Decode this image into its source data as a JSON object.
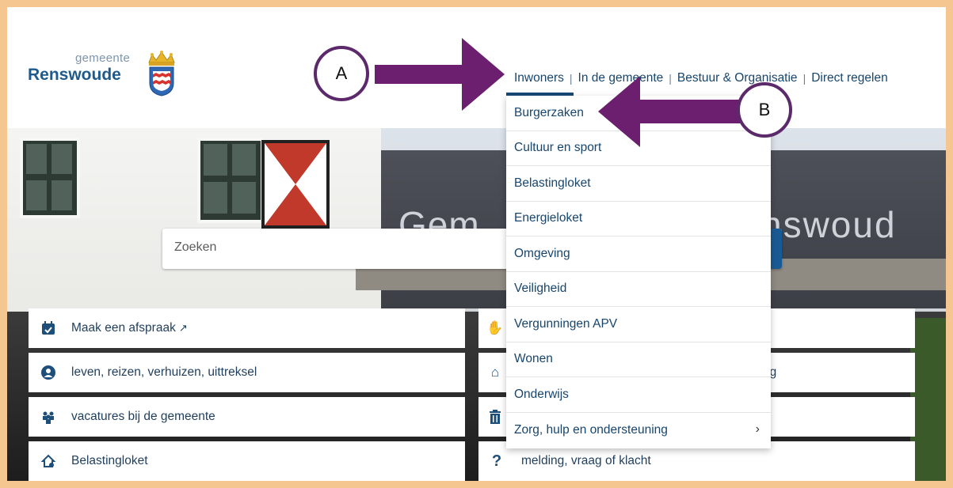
{
  "logo": {
    "small": "gemeente",
    "name": "Renswoude"
  },
  "nav": {
    "items": [
      "Inwoners",
      "In de gemeente",
      "Bestuur & Organisatie",
      "Direct regelen"
    ],
    "separator": "|"
  },
  "hero": {
    "sign_text_left": "Gem",
    "sign_text_right": "nswoud"
  },
  "search": {
    "placeholder": "Zoeken"
  },
  "quick_links_left": [
    {
      "icon": "calendar-check-icon",
      "label": "Maak een afspraak"
    },
    {
      "icon": "user-circle-icon",
      "label": "leven, reizen, verhuizen, uittreksel"
    },
    {
      "icon": "people-group-icon",
      "label": "vacatures bij de gemeente"
    },
    {
      "icon": "house-coin-icon",
      "label": "Belastingloket"
    }
  ],
  "quick_links_right": [
    {
      "icon": "hands-icon",
      "label": ""
    },
    {
      "icon": "house-user-icon",
      "label": "ng"
    },
    {
      "icon": "trash-icon",
      "label": ""
    },
    {
      "icon": "question-icon",
      "label": "melding, vraag of klacht"
    }
  ],
  "dropdown": {
    "items": [
      "Burgerzaken",
      "Cultuur en sport",
      "Belastingloket",
      "Energieloket",
      "Omgeving",
      "Veiligheid",
      "Vergunningen APV",
      "Wonen",
      "Onderwijs",
      "Zorg, hulp en ondersteuning"
    ],
    "chevron": "›"
  },
  "annotations": {
    "a": "A",
    "b": "B",
    "arrow_color": "#6b1f6e"
  },
  "colors": {
    "brand": "#1e5a8c",
    "nav_text": "#17456b",
    "frame": "#f5c68f"
  }
}
